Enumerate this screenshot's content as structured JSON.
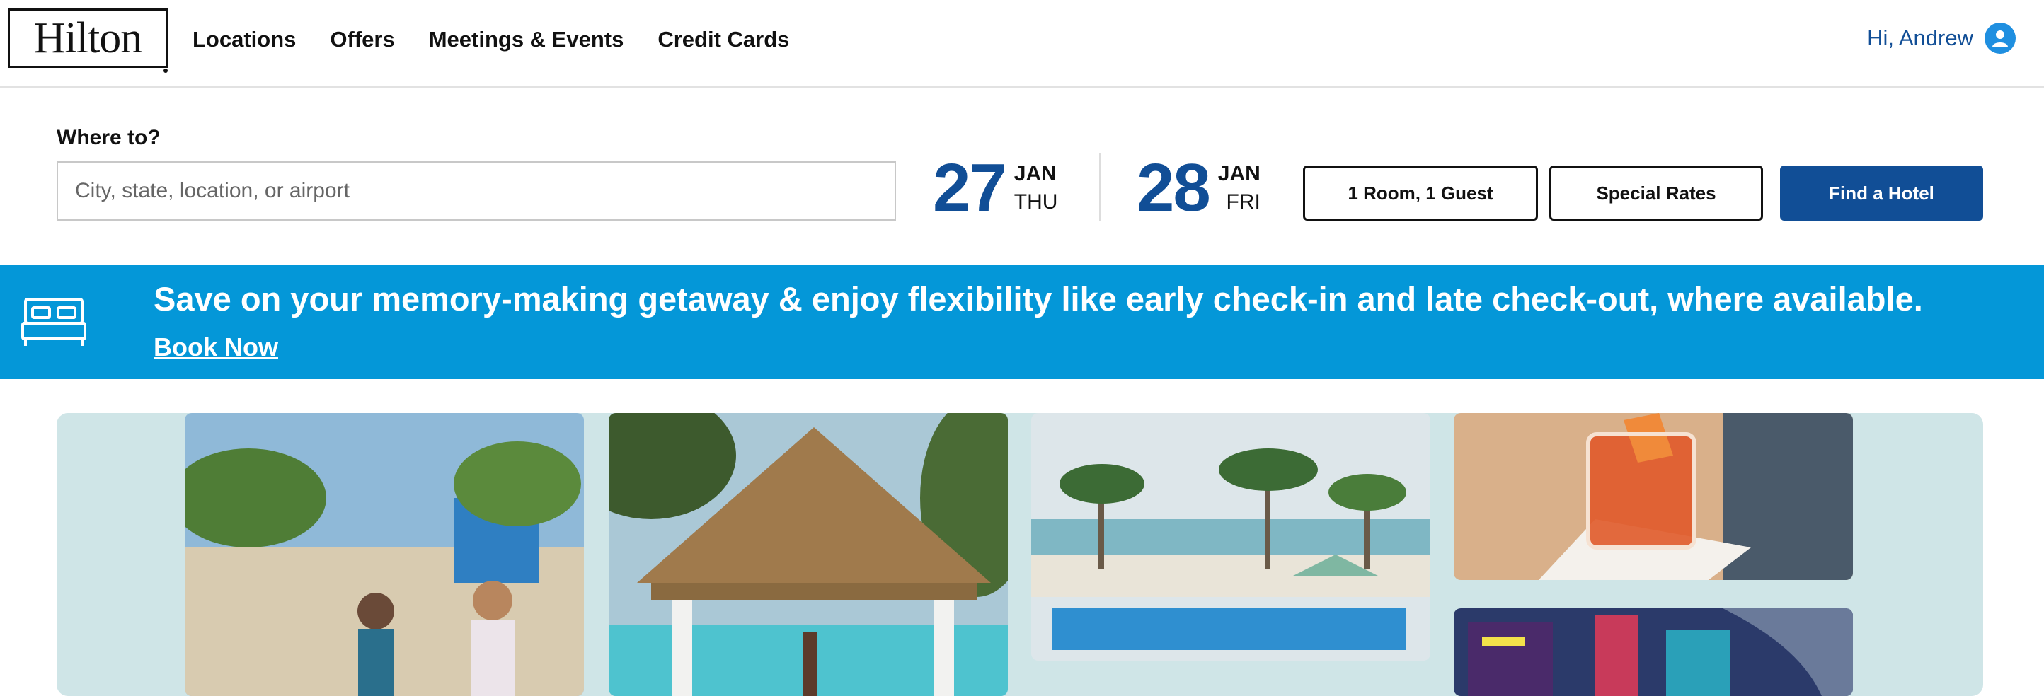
{
  "header": {
    "logo_text": "Hilton",
    "nav": [
      "Locations",
      "Offers",
      "Meetings & Events",
      "Credit Cards"
    ],
    "greeting": "Hi, Andrew"
  },
  "search": {
    "label": "Where to?",
    "placeholder": "City, state, location, or airport",
    "value": ""
  },
  "dates": {
    "checkin": {
      "day": "27",
      "month": "JAN",
      "weekday": "THU"
    },
    "checkout": {
      "day": "28",
      "month": "JAN",
      "weekday": "FRI"
    }
  },
  "buttons": {
    "rooms": "1 Room, 1 Guest",
    "special_rates": "Special Rates",
    "find": "Find a Hotel"
  },
  "banner": {
    "text": "Save on your memory-making getaway & enjoy flexibility like early check-in and late check-out, where available.",
    "link": "Book Now"
  },
  "colors": {
    "brand_blue": "#114e96",
    "banner_blue": "#0497d8",
    "avatar_blue": "#1f8fe0",
    "collage_bg": "#cfe5e7"
  },
  "icons": [
    "user-avatar-icon",
    "bed-icon"
  ]
}
